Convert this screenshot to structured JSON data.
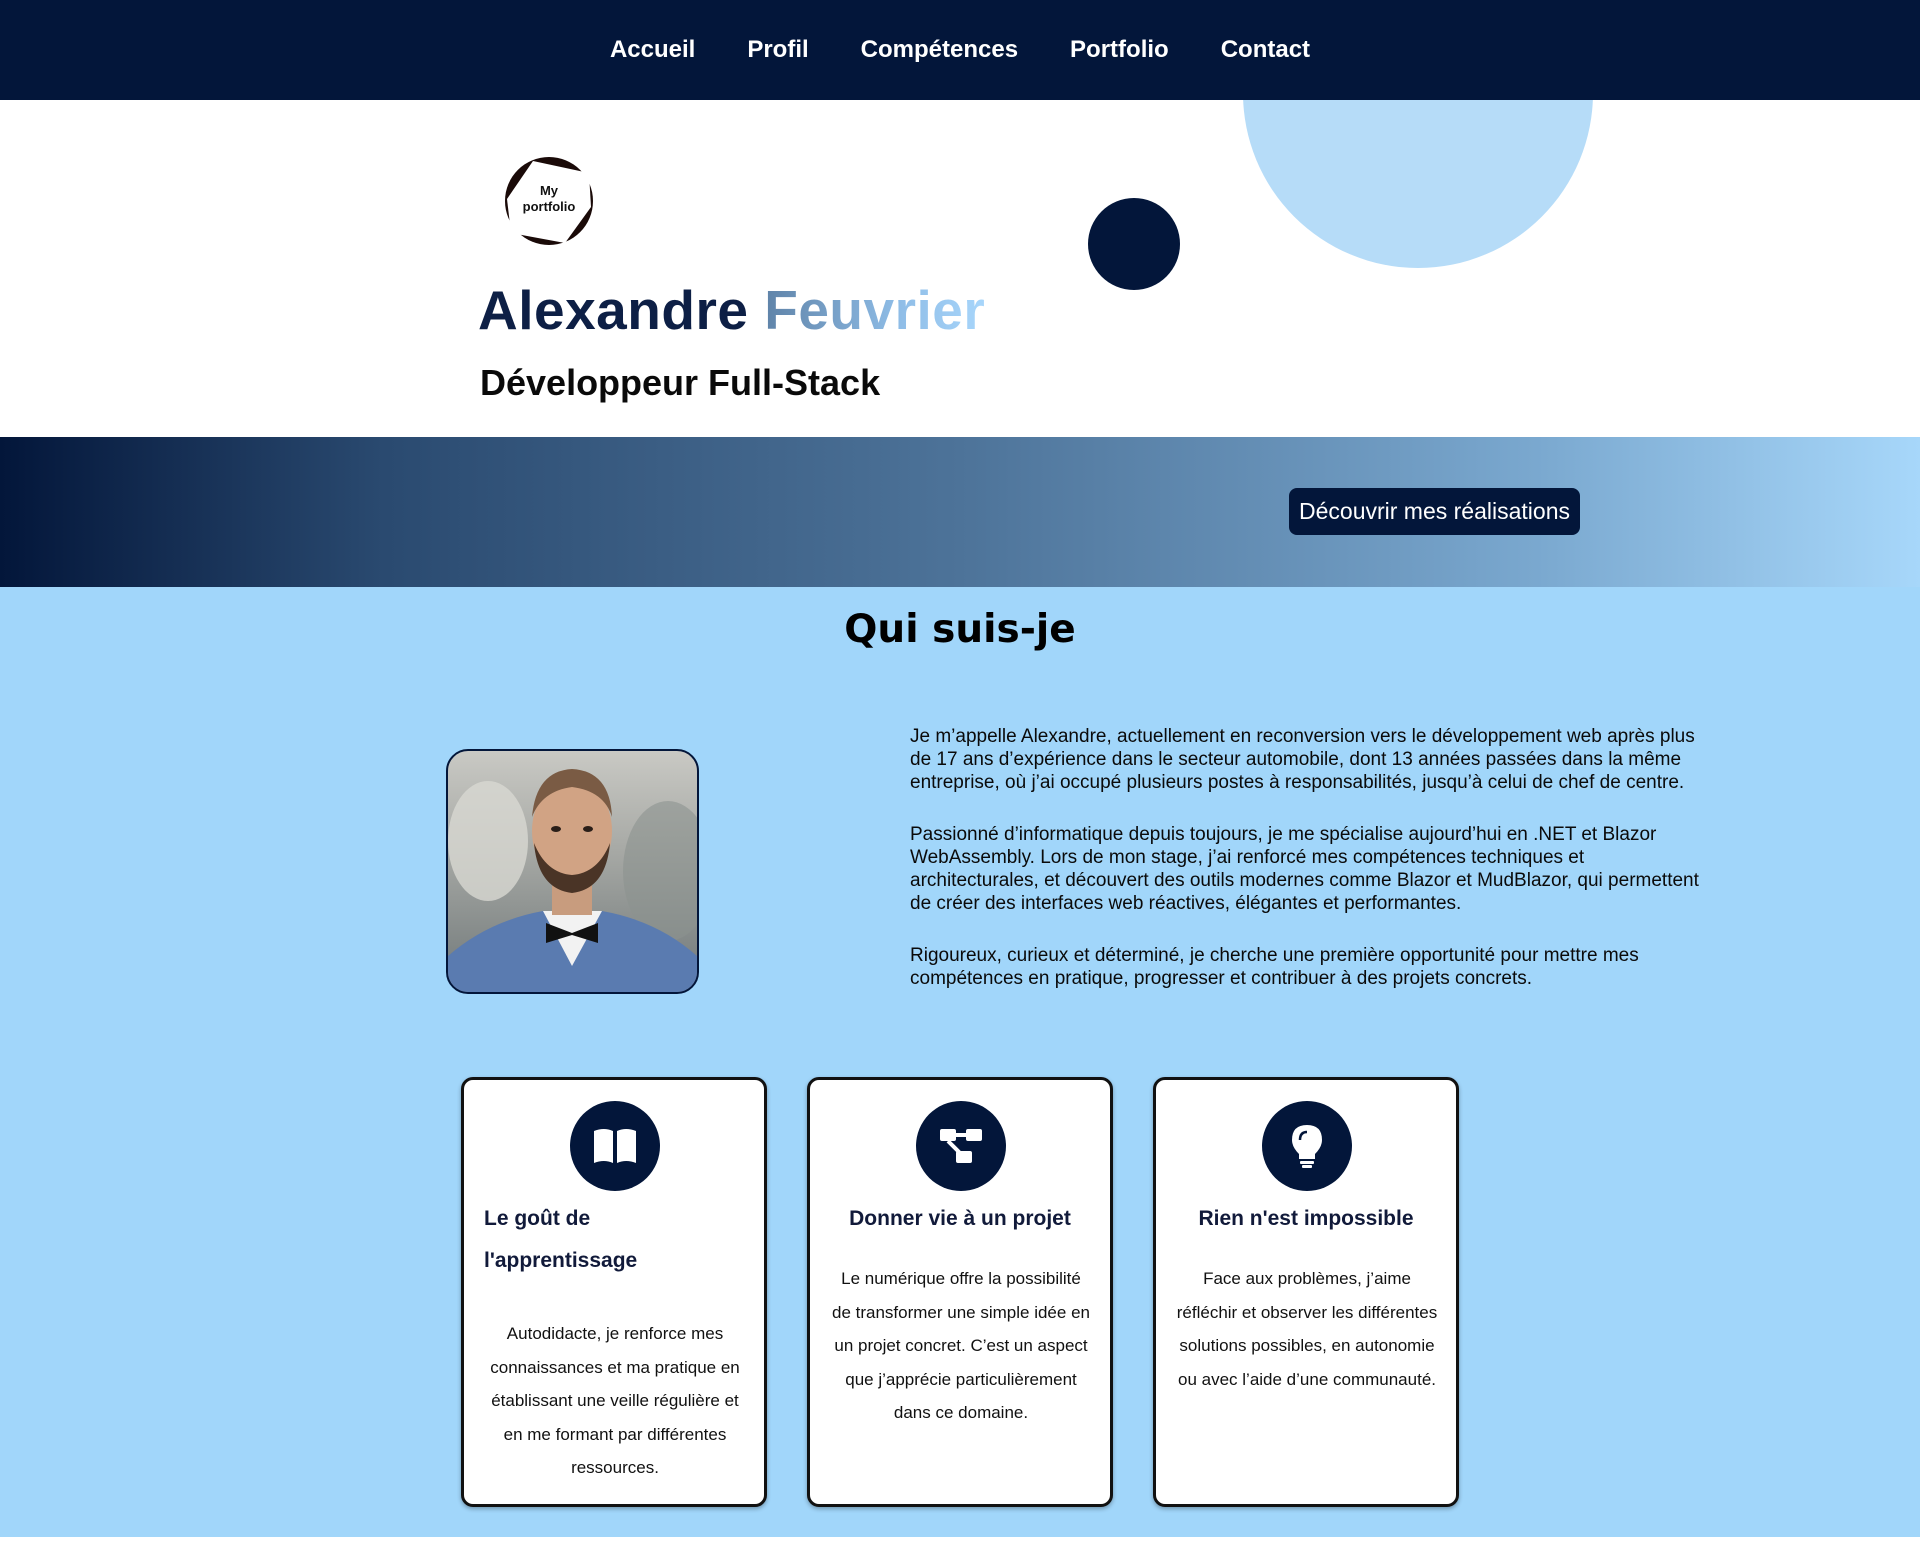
{
  "nav": {
    "items": [
      "Accueil",
      "Profil",
      "Compétences",
      "Portfolio",
      "Contact"
    ]
  },
  "hero": {
    "logo_line1": "My",
    "logo_line2": "portfolio",
    "first_name": "Alexandre",
    "last_name": "Feuvrier",
    "subtitle": "Développeur Full-Stack",
    "cta_label": "Découvrir mes réalisations"
  },
  "about": {
    "title": "Qui suis-je",
    "paragraphs": [
      "Je m’appelle Alexandre, actuellement en reconversion vers le développement web après plus de 17 ans d’expérience dans le secteur automobile, dont 13 années passées dans la même entreprise, où j’ai occupé plusieurs postes à responsabilités, jusqu’à celui de chef de centre.",
      "Passionné d’informatique depuis toujours, je me spécialise aujourd’hui en .NET et Blazor WebAssembly. Lors de mon stage, j’ai renforcé mes compétences techniques et architecturales, et découvert des outils modernes comme Blazor et MudBlazor, qui permettent de créer des interfaces web réactives, élégantes et performantes.",
      "Rigoureux, curieux et déterminé, je cherche une première opportunité pour mettre mes compétences en pratique, progresser et contribuer à des projets concrets."
    ]
  },
  "cards": [
    {
      "icon": "book-icon",
      "title": "Le goût de l'apprentissage",
      "text": "Autodidacte, je renforce mes connaissances et ma pratique en établissant une veille régulière et en me formant par différentes ressources."
    },
    {
      "icon": "project-diagram-icon",
      "title": "Donner vie à un projet",
      "text": "Le numérique offre la possibilité de transformer une simple idée en un projet concret. C’est un aspect que j’apprécie particulièrement dans ce domaine."
    },
    {
      "icon": "lightbulb-icon",
      "title": "Rien n'est impossible",
      "text": "Face aux problèmes, j’aime réfléchir et observer les différentes solutions possibles, en autonomie ou avec l’aide d’une communauté."
    }
  ],
  "colors": {
    "navy": "#03163a",
    "light_blue": "#a1d6fa",
    "circle_blue": "#b6dcf8"
  }
}
